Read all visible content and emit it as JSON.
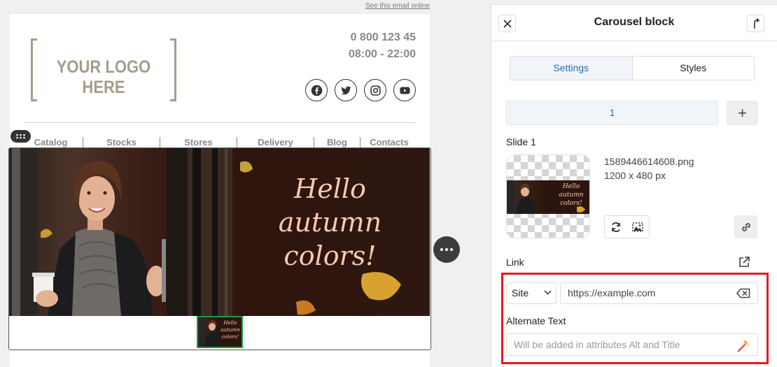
{
  "email": {
    "see_online": "See this email online",
    "logo_text": "YOUR LOGO HERE",
    "phone": "0 800 123 45",
    "hours": "08:00 - 22:00",
    "socials": [
      "facebook-icon",
      "twitter-icon",
      "instagram-icon",
      "youtube-icon"
    ],
    "nav": [
      "Catalog",
      "Stocks",
      "Stores",
      "Delivery",
      "Blog",
      "Contacts"
    ],
    "banner_text": [
      "Hello",
      "autumn",
      "colors!"
    ]
  },
  "panel": {
    "title": "Carousel block",
    "tabs": {
      "settings": "Settings",
      "styles": "Styles"
    },
    "slide_tab": "1",
    "add_slide": "+",
    "slide_label": "Slide 1",
    "file_name": "1589446614608.png",
    "file_size": "1200 x 480 px",
    "link_label": "Link",
    "link_type": "Site",
    "link_url": "https://example.com",
    "alt_label": "Alternate Text",
    "alt_placeholder": "Will be added in attributes Alt and Title"
  },
  "colors": {
    "accent": "#2f6eb8",
    "highlight": "#e41b23",
    "thumb_active": "#1a9c3f",
    "logo": "#a59d8a"
  }
}
